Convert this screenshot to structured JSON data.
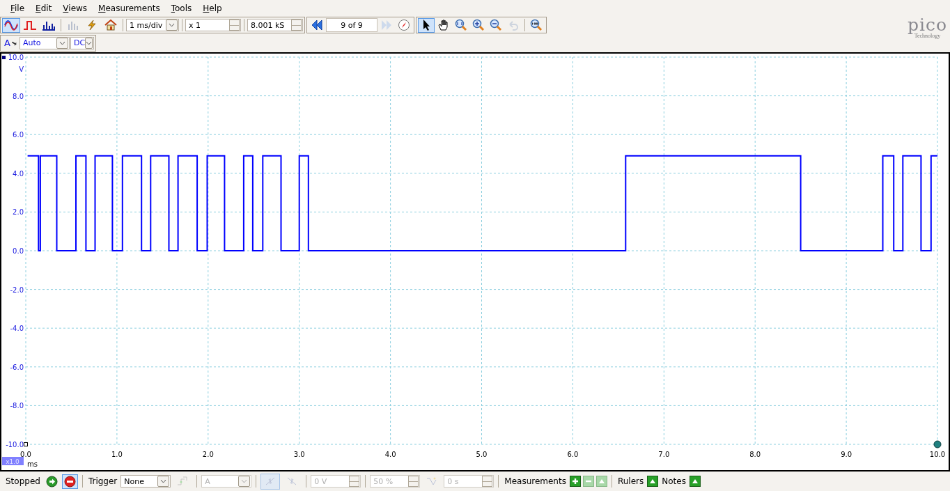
{
  "menu": [
    {
      "label": "File"
    },
    {
      "label": "Edit"
    },
    {
      "label": "Views"
    },
    {
      "label": "Measurements"
    },
    {
      "label": "Tools"
    },
    {
      "label": "Help"
    }
  ],
  "toolbar": {
    "modes": [
      {
        "kind": "scope",
        "selected": true
      },
      {
        "kind": "persistence",
        "selected": false
      },
      {
        "kind": "spectrum",
        "selected": false
      }
    ],
    "actions": [
      {
        "kind": "channels",
        "disabled": true
      },
      {
        "kind": "lightning",
        "disabled": false
      },
      {
        "kind": "home",
        "disabled": false
      }
    ],
    "timebase": "1 ms/div",
    "zoom": "x 1",
    "samples": "8.001 kS",
    "buffer": "9 of 9",
    "tools": [
      {
        "kind": "pointer",
        "selected": true,
        "disabled": false
      },
      {
        "kind": "hand",
        "selected": false,
        "disabled": false
      },
      {
        "kind": "zoom-fit",
        "selected": false,
        "disabled": false
      },
      {
        "kind": "zoom-in",
        "selected": false,
        "disabled": false
      },
      {
        "kind": "zoom-out",
        "selected": false,
        "disabled": false
      },
      {
        "kind": "undo",
        "selected": false,
        "disabled": true
      },
      {
        "kind": "zoom-100",
        "selected": false,
        "disabled": false
      }
    ]
  },
  "logo": {
    "name": "pico",
    "tagline": "Technology"
  },
  "channel": {
    "label": "A",
    "range": "Auto",
    "coupling": "DC"
  },
  "scope": {
    "zoom_badge": "x1.0",
    "chart_data": {
      "type": "line",
      "grid": true,
      "ylabel": "V",
      "xlabel": "ms",
      "xlim": [
        0,
        10
      ],
      "ylim": [
        -10,
        10
      ],
      "xticks": [
        {
          "value": 0,
          "label": "0.0"
        },
        {
          "value": 1,
          "label": "1.0"
        },
        {
          "value": 2,
          "label": "2.0"
        },
        {
          "value": 3,
          "label": "3.0"
        },
        {
          "value": 4,
          "label": "4.0"
        },
        {
          "value": 5,
          "label": "5.0"
        },
        {
          "value": 6,
          "label": "6.0"
        },
        {
          "value": 7,
          "label": "7.0"
        },
        {
          "value": 8,
          "label": "8.0"
        },
        {
          "value": 9,
          "label": "9.0"
        },
        {
          "value": 10,
          "label": "10.0"
        }
      ],
      "yticks": [
        {
          "value": 10,
          "label": "10.0"
        },
        {
          "value": 8,
          "label": "8.0"
        },
        {
          "value": 6,
          "label": "6.0"
        },
        {
          "value": 4,
          "label": "4.0"
        },
        {
          "value": 2,
          "label": "2.0"
        },
        {
          "value": 0,
          "label": "0.0"
        },
        {
          "value": -2,
          "label": "-2.0"
        },
        {
          "value": -4,
          "label": "-4.0"
        },
        {
          "value": -6,
          "label": "-6.0"
        },
        {
          "value": -8,
          "label": "-8.0"
        },
        {
          "value": -10,
          "label": "-10.0"
        }
      ],
      "x": [
        0.02,
        0.14,
        0.14,
        0.16,
        0.16,
        0.34,
        0.34,
        0.55,
        0.55,
        0.66,
        0.66,
        0.76,
        0.76,
        0.95,
        0.95,
        1.06,
        1.06,
        1.27,
        1.27,
        1.37,
        1.37,
        1.57,
        1.57,
        1.67,
        1.67,
        1.88,
        1.88,
        1.99,
        1.99,
        2.18,
        2.18,
        2.39,
        2.39,
        2.49,
        2.49,
        2.6,
        2.6,
        2.8,
        2.8,
        3.0,
        3.0,
        3.1,
        3.1,
        6.58,
        6.58,
        8.5,
        8.5,
        9.4,
        9.4,
        9.52,
        9.52,
        9.62,
        9.62,
        9.82,
        9.82,
        9.93,
        9.93,
        10.0
      ],
      "series": [
        {
          "color": "#0000ff",
          "values": [
            4.9,
            4.9,
            0,
            0,
            4.9,
            4.9,
            0,
            0,
            4.9,
            4.9,
            0,
            0,
            4.9,
            4.9,
            0,
            0,
            4.9,
            4.9,
            0,
            0,
            4.9,
            4.9,
            0,
            0,
            4.9,
            4.9,
            0,
            0,
            4.9,
            4.9,
            0,
            0,
            4.9,
            4.9,
            0,
            0,
            4.9,
            4.9,
            0,
            0,
            4.9,
            4.9,
            0,
            0,
            4.9,
            4.9,
            0,
            0,
            4.9,
            4.9,
            0,
            0,
            4.9,
            4.9,
            0,
            0,
            4.9,
            4.9
          ]
        }
      ]
    }
  },
  "status": {
    "state": "Stopped",
    "run": {
      "selected": false
    },
    "stop": {
      "selected": true
    },
    "trigger_label": "Trigger",
    "trigger_mode": "None",
    "trigger_channel": {
      "value": "A",
      "disabled": true
    },
    "threshold": {
      "value": "0 V",
      "disabled": true
    },
    "pre_trigger": {
      "value": "50 %",
      "disabled": true
    },
    "delay": {
      "value": "0 s",
      "disabled": true
    },
    "measurements_label": "Measurements",
    "measurement_buttons": [
      {
        "kind": "add",
        "disabled": false
      },
      {
        "kind": "remove",
        "disabled": true
      },
      {
        "kind": "edit",
        "disabled": true
      }
    ],
    "rulers_label": "Rulers",
    "notes_label": "Notes"
  }
}
